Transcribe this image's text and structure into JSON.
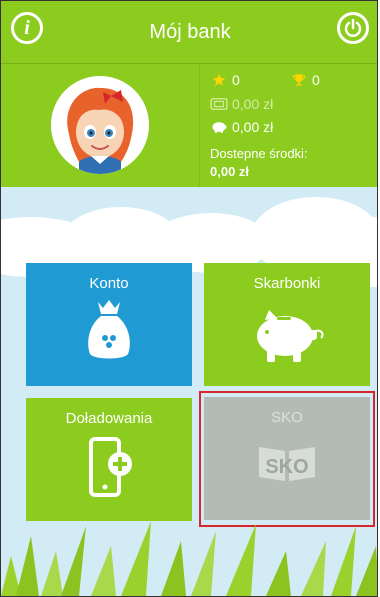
{
  "header": {
    "title": "Mój bank",
    "info_icon": "info-icon",
    "power_icon": "power-icon"
  },
  "profile": {
    "stars": "0",
    "trophies": "0",
    "wallet": "0,00 zł",
    "piggy": "0,00 zł",
    "available_label": "Dostepne środki:",
    "available_value": "0,00 zł"
  },
  "tiles": {
    "konto": "Konto",
    "skarbonki": "Skarbonki",
    "doladowania": "Doładowania",
    "sko": "SKO",
    "sko_logo": "SKO"
  },
  "colors": {
    "green": "#8ccc1f",
    "blue": "#1f9ad3",
    "disabled": "#b3bbb6",
    "highlight": "#d9262c"
  }
}
